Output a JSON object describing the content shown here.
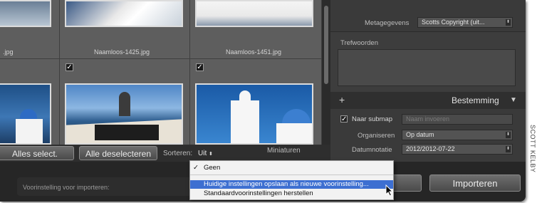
{
  "grid": {
    "row1": [
      {
        "filename": ".jpg"
      },
      {
        "filename": "Naamloos-1425.jpg"
      },
      {
        "filename": "Naamloos-1451.jpg"
      }
    ],
    "row2_checked": [
      true,
      true
    ]
  },
  "toolbar": {
    "select_all": "Alles select.",
    "deselect_all": "Alle deselecteren",
    "sort_label": "Sorteren:",
    "sort_value": "Uit",
    "thumbnails_label": "Miniaturen"
  },
  "panel": {
    "metadata_label": "Metagegevens",
    "metadata_value": "Scotts Copyright (uit...",
    "keywords_label": "Trefwoorden",
    "destination_title": "Bestemming",
    "plus_icon": "+",
    "subfolder_label": "Naar submap",
    "subfolder_placeholder": "Naam invoeren",
    "organize_label": "Organiseren",
    "organize_value": "Op datum",
    "date_format_label": "Datumnotatie",
    "date_format_value": "2012/2012-07-22"
  },
  "bottom": {
    "preset_label": "Voorinstelling voor importeren:",
    "import_button": "Importeren"
  },
  "menu": {
    "items": [
      {
        "label": "Geen",
        "checked": true
      },
      {
        "label": "Huidige instellingen opslaan als nieuwe voorinstelling...",
        "highlighted": true
      },
      {
        "label": "Standaardvoorinstellingen herstellen"
      }
    ]
  },
  "credit": "SCOTT KELBY",
  "colors": {
    "highlight": "#3d6fd1",
    "panel": "#3c3c3c",
    "background": "#3a3a3a"
  }
}
